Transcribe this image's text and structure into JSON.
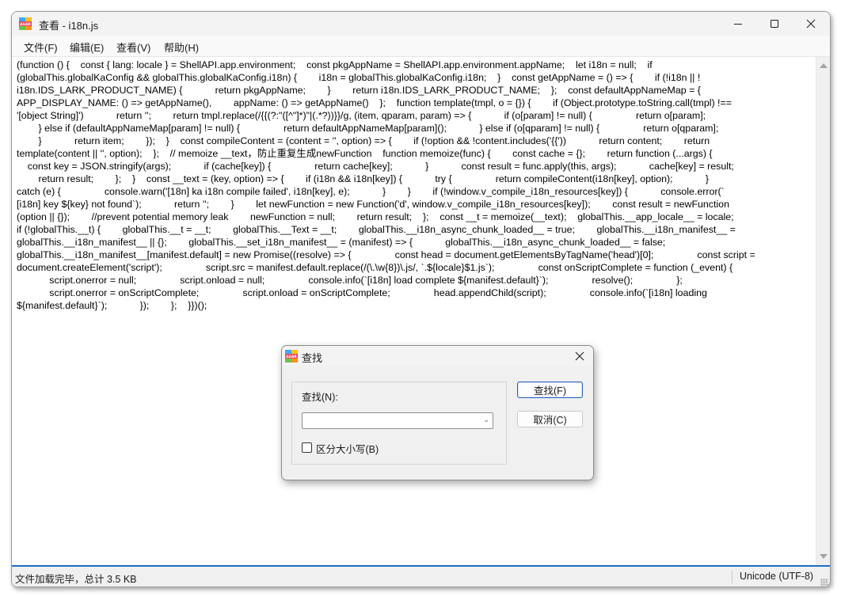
{
  "window": {
    "title": "查看 - i18n.js",
    "app_icon": "asar-icon",
    "controls": {
      "minimize": "minimize-icon",
      "maximize": "maximize-icon",
      "close": "close-icon"
    }
  },
  "menubar": {
    "items": [
      {
        "label": "文件(F)"
      },
      {
        "label": "编辑(E)"
      },
      {
        "label": "查看(V)"
      },
      {
        "label": "帮助(H)"
      }
    ]
  },
  "editor": {
    "lines": [
      "(function () {    const { lang: locale } = ShellAPI.app.environment;    const pkgAppName = ShellAPI.app.environment.appName;    let i18n = null;    if",
      "(globalThis.globalKaConfig && globalThis.globalKaConfig.i18n) {        i18n = globalThis.globalKaConfig.i18n;    }    const getAppName = () => {        if (!i18n || !",
      "i18n.IDS_LARK_PRODUCT_NAME) {            return pkgAppName;        }        return i18n.IDS_LARK_PRODUCT_NAME;    };    const defaultAppNameMap = {",
      "APP_DISPLAY_NAME: () => getAppName(),        appName: () => getAppName()    };    function template(tmpl, o = {}) {        if (Object.prototype.toString.call(tmpl) !==",
      "'[object String]')            return '';        return tmpl.replace(/{{(?:\"([^\"]*)\"|(.*?))}}/g, (item, qparam, param) => {            if (o[param] != null) {                return o[param];",
      "        } else if (defaultAppNameMap[param] != null) {                return defaultAppNameMap[param]();            } else if (o[qparam] != null) {                return o[qparam];",
      "        }            return item;        });    }    const compileContent = (content = '', option) => {        if (!option && !content.includes('{{'))            return content;        return",
      "template(content || '', option);    };    // memoize __text，防止重复生成newFunction    function memoize(func) {        const cache = {};        return function (...args) {",
      "    const key = JSON.stringify(args);            if (cache[key]) {                return cache[key];            }            const result = func.apply(this, args);            cache[key] = result;",
      "        return result;        };    }    const __text = (key, option) => {        if (i18n && i18n[key]) {            try {                return compileContent(i18n[key], option);            }",
      "catch (e) {                console.warn('[18n] ka i18n compile failed', i18n[key], e);            }        }        if (!window.v_compile_i18n_resources[key]) {            console.error(`",
      "[i18n] key ${key} not found`);            return '';        }        let newFunction = new Function('d', window.v_compile_i18n_resources[key]);        const result = newFunction",
      "(option || {});        //prevent potential memory leak        newFunction = null;        return result;    };    const __t = memoize(__text);    globalThis.__app_locale__ = locale;",
      "if (!globalThis.__t) {        globalThis.__t = __t;        globalThis.__Text = __t;        globalThis.__i18n_async_chunk_loaded__ = true;        globalThis.__i18n_manifest__ =",
      "globalThis.__i18n_manifest__ || {};        globalThis.__set_i18n_manifest__ = (manifest) => {            globalThis.__i18n_async_chunk_loaded__ = false;",
      "globalThis.__i18n_manifest__[manifest.default] = new Promise((resolve) => {                const head = document.getElementsByTagName('head')[0];                const script =",
      "document.createElement('script');                script.src = manifest.default.replace(/(\\.\\w{8})\\.js/, `.${locale}$1.js`);                const onScriptComplete = function (_event) {",
      "            script.onerror = null;                script.onload = null;                console.info(`[i18n] load complete ${manifest.default}`);                resolve();                };",
      "            script.onerror = onScriptComplete;                script.onload = onScriptComplete;                head.appendChild(script);                console.info(`[i18n] loading",
      "${manifest.default}`);            });        };    }})();"
    ]
  },
  "statusbar": {
    "left": "文件加载完毕，总计 3.5 KB",
    "right": "Unicode (UTF-8)"
  },
  "find_dialog": {
    "title": "查找",
    "find_label": "查找(N):",
    "find_value": "",
    "case_sensitive_label": "区分大小写(B)",
    "case_sensitive_checked": false,
    "find_button": "查找(F)",
    "cancel_button": "取消(C)"
  }
}
